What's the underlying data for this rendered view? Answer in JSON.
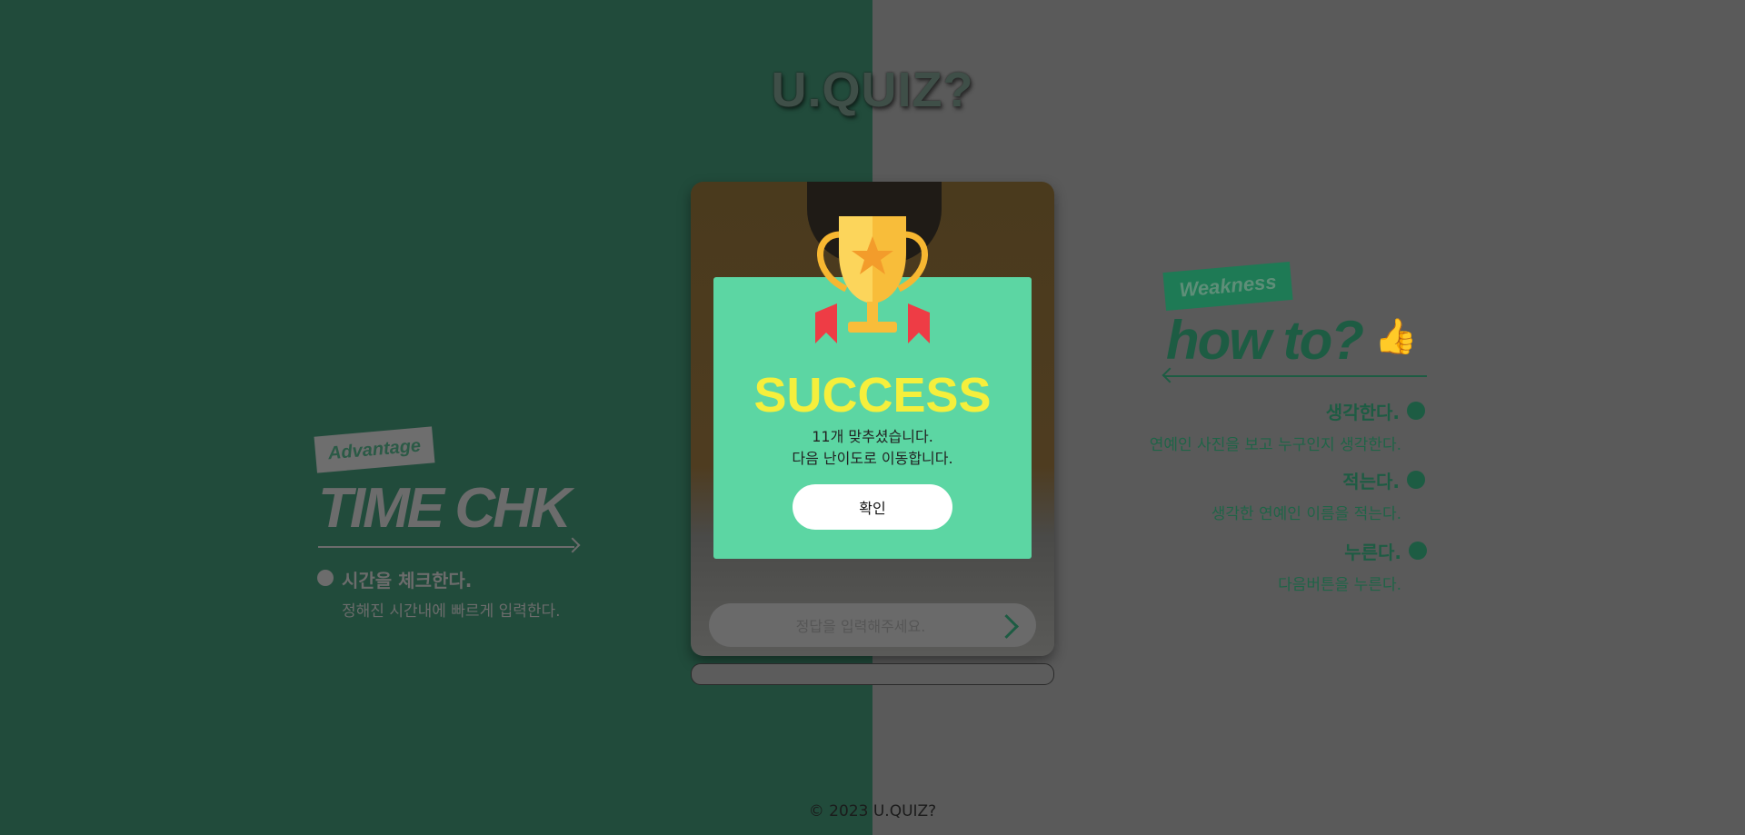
{
  "app": {
    "logo": "U.QUIZ?"
  },
  "advantage": {
    "tag": "Advantage",
    "title": "TIME CHK",
    "heading": "시간을 체크한다.",
    "description": "정해진 시간내에 빠르게 입력한다."
  },
  "weakness": {
    "tag": "Weakness",
    "title": "how to?",
    "steps": [
      {
        "heading": "생각한다.",
        "description": "연예인 사진을 보고 누구인지 생각한다."
      },
      {
        "heading": "적는다.",
        "description": "생각한 연예인 이름을 적는다."
      },
      {
        "heading": "누른다.",
        "description": "다음버튼을 누른다."
      }
    ]
  },
  "quiz": {
    "answer_placeholder": "정답을 입력해주세요.",
    "next_icon": "chevron-right-icon"
  },
  "modal": {
    "icon": "trophy-icon",
    "title": "SUCCESS",
    "line1": "11개 맞추셨습니다.",
    "line2": "다음 난이도로 이동합니다.",
    "confirm_label": "확인"
  },
  "footer": {
    "copyright": "© 2023 U.QUIZ?"
  },
  "colors": {
    "left_bg": "#214b3b",
    "right_bg": "#5a5a5a",
    "modal_bg": "#5cd6a3",
    "success_text": "#f5ef3c",
    "accent_green": "#1d5c43"
  }
}
